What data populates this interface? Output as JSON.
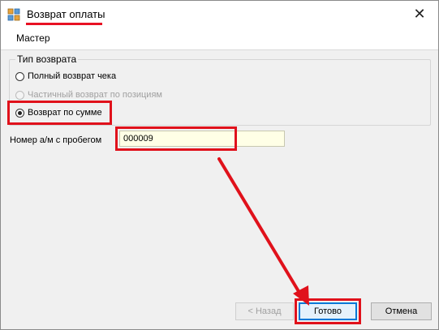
{
  "window": {
    "title": "Возврат оплаты",
    "close_glyph": "✕"
  },
  "wizard_header": "Мастер",
  "refund_type": {
    "group_title": "Тип возврата",
    "options": [
      {
        "label": "Полный возврат чека",
        "selected": false,
        "enabled": true
      },
      {
        "label": "Частичный возврат по позициям",
        "selected": false,
        "enabled": false
      },
      {
        "label": "Возврат по сумме",
        "selected": true,
        "enabled": true
      }
    ]
  },
  "mileage_field": {
    "label": "Номер а/м с пробегом",
    "value": "000009"
  },
  "buttons": {
    "back": "< Назад",
    "finish": "Готово",
    "cancel": "Отмена"
  },
  "colors": {
    "highlight": "#e0111b",
    "input_background": "#ffffe6",
    "window_background": "#f0f0f0"
  }
}
